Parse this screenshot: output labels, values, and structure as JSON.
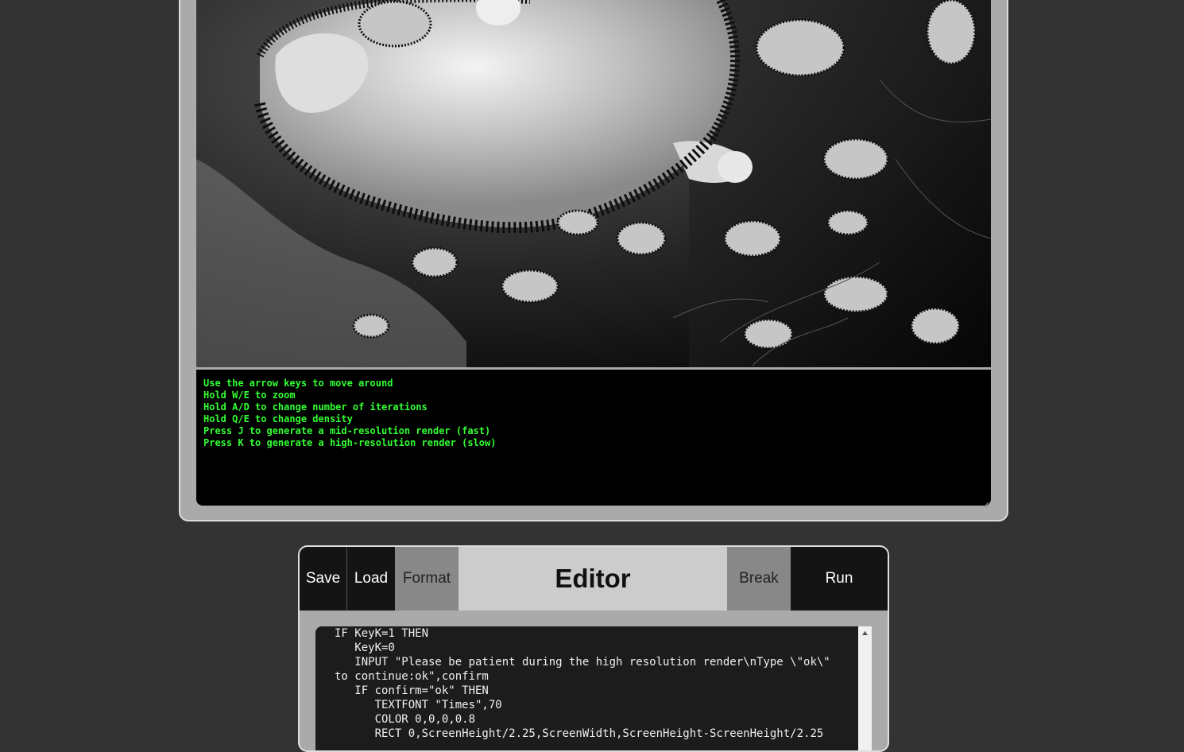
{
  "console": {
    "lines": [
      "Use the arrow keys to move around",
      "Hold W/E to zoom",
      "Hold A/D to change number of iterations",
      "Hold Q/E to change density",
      "Press J to generate a mid-resolution render (fast)",
      "Press K to generate a high-resolution render (slow)"
    ],
    "text_color": "#33ff33"
  },
  "editor": {
    "title": "Editor",
    "buttons": {
      "save": "Save",
      "load": "Load",
      "format": "Format",
      "break": "Break",
      "run": "Run"
    },
    "code_lines": [
      "IF KeyK=1 THEN",
      "   KeyK=0",
      "   INPUT \"Please be patient during the high resolution render\\nType \\\"ok\\\"",
      "to continue:ok\",confirm",
      "   IF confirm=\"ok\" THEN",
      "      TEXTFONT \"Times\",70",
      "      COLOR 0,0,0,0.8",
      "      RECT 0,ScreenHeight/2.25,ScreenWidth,ScreenHeight-ScreenHeight/2.25"
    ]
  },
  "icons": {
    "scroll_up": "triangle-up-icon",
    "resize": "resize-grip-icon"
  }
}
